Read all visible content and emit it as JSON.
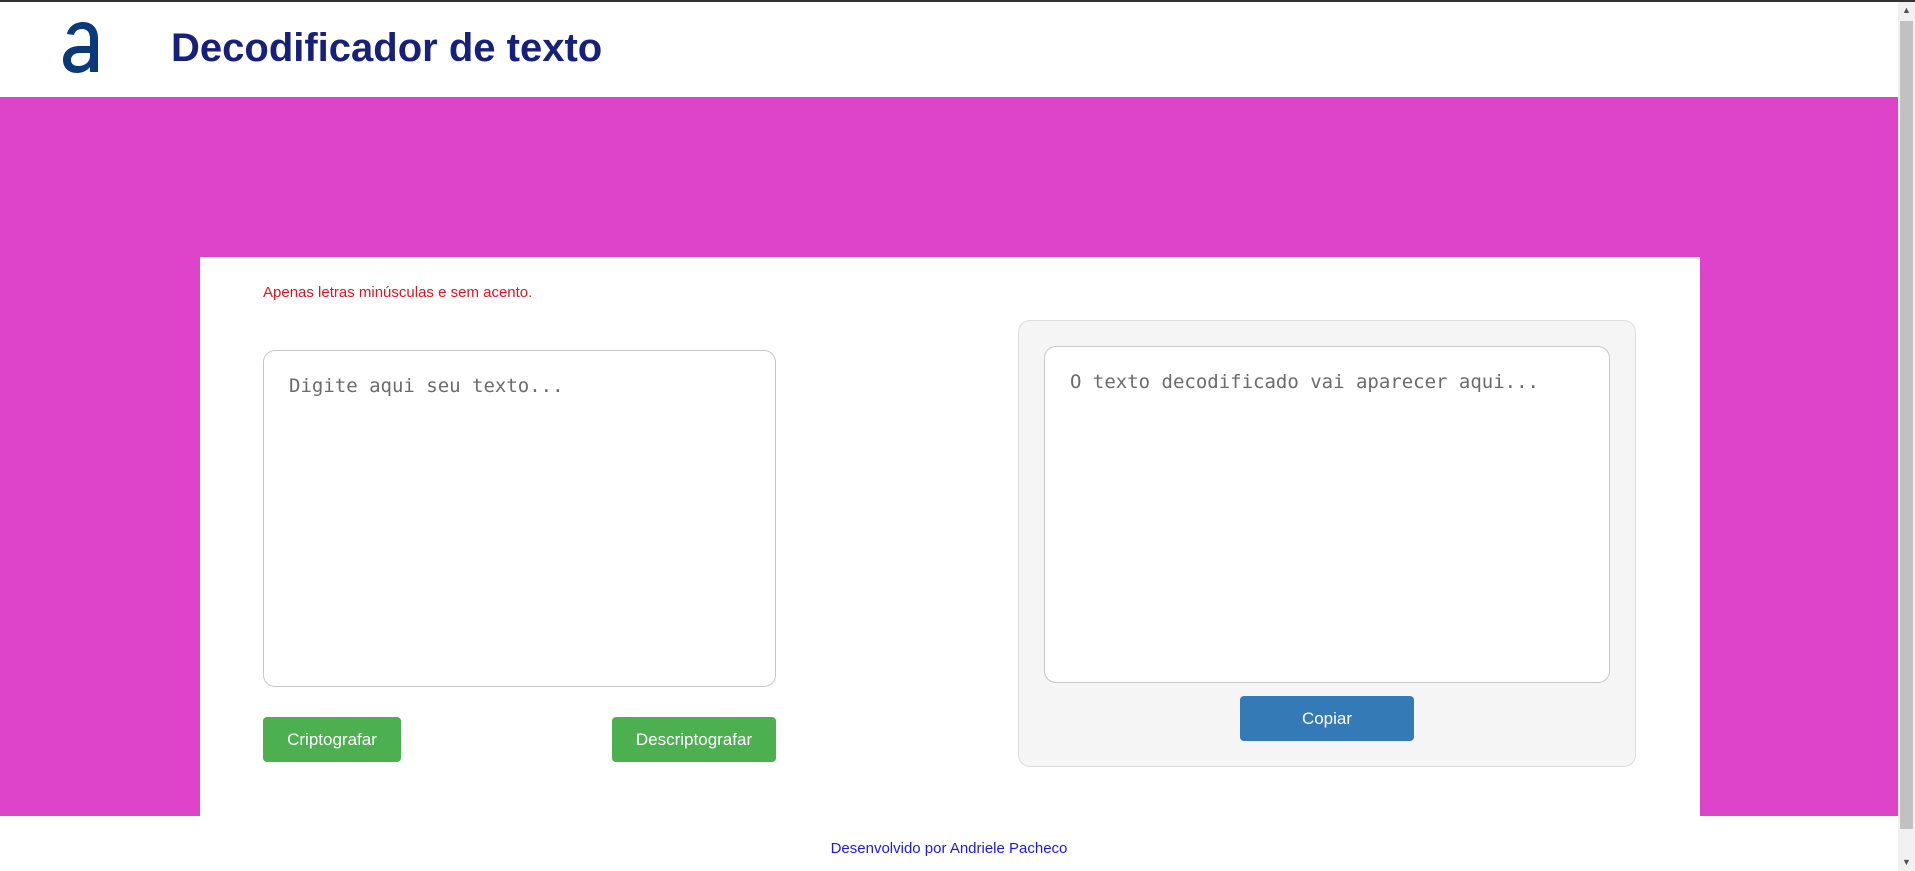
{
  "header": {
    "title": "Decodificador de texto",
    "logo_icon": "alura-a-logo-icon"
  },
  "main": {
    "hint": "Apenas letras minúsculas e sem acento.",
    "input": {
      "value": "",
      "placeholder": "Digite aqui seu texto..."
    },
    "encrypt_label": "Criptografar",
    "decrypt_label": "Descriptografar",
    "output": {
      "value": "",
      "placeholder": "O texto decodificado vai aparecer aqui..."
    },
    "copy_label": "Copiar"
  },
  "footer": {
    "text": "Desenvolvido por Andriele Pacheco"
  },
  "colors": {
    "accent_band": "#dd44c9",
    "title": "#17207a",
    "logo": "#0b3a78",
    "hint": "#e0141e",
    "button_green": "#4caf50",
    "button_blue": "#337ab7",
    "footer_link": "#1a1ae6"
  }
}
